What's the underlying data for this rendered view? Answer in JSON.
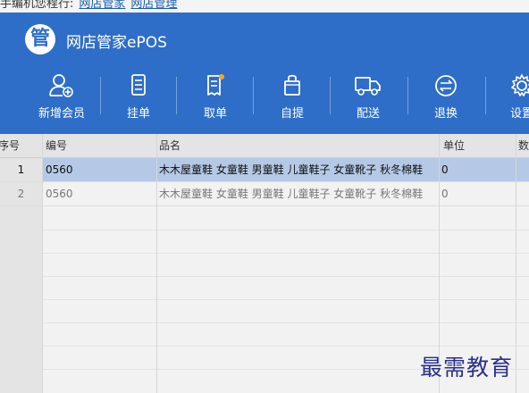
{
  "top_strip": {
    "text": "手编机您程行:",
    "links": [
      "网店管家",
      "网店管理"
    ]
  },
  "app": {
    "logo_char": "管",
    "title": "网店管家ePOS"
  },
  "toolbar": [
    {
      "label": "新增会员",
      "icon": "add-member-icon"
    },
    {
      "label": "挂单",
      "icon": "hang-order-icon"
    },
    {
      "label": "取单",
      "icon": "retrieve-order-icon"
    },
    {
      "label": "自提",
      "icon": "pickup-bag-icon"
    },
    {
      "label": "配送",
      "icon": "delivery-truck-icon"
    },
    {
      "label": "退换",
      "icon": "exchange-icon"
    },
    {
      "label": "设置",
      "icon": "gear-icon"
    }
  ],
  "table": {
    "columns": [
      "序号",
      "编号",
      "品名",
      "单位",
      "数"
    ],
    "rows": [
      {
        "num": "1",
        "code": "0560",
        "name": "木木屋童鞋 女童鞋 男童鞋 儿童鞋子 女童靴子 秋冬棉鞋",
        "unit": "0",
        "selected": true
      },
      {
        "num": "2",
        "code": "0560",
        "name": "木木屋童鞋 女童鞋 男童鞋 儿童鞋子 女童靴子 秋冬棉鞋",
        "unit": "0",
        "selected": false
      }
    ]
  },
  "colors": {
    "header_blue": "#2f6ec8",
    "selected_row": "#b5c9e6"
  },
  "watermark": "最需教育"
}
